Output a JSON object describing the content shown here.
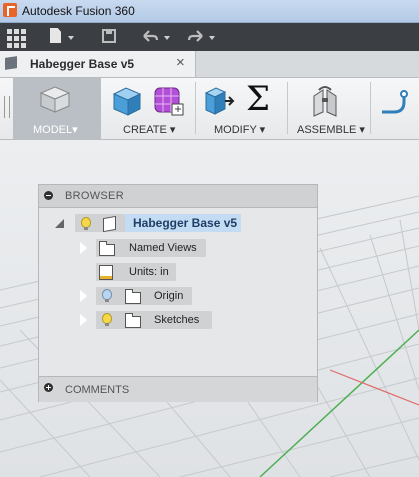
{
  "window": {
    "title": "Autodesk Fusion 360"
  },
  "quick_access": {
    "icons": [
      "apps-grid-icon",
      "file-icon",
      "save-icon",
      "undo-icon",
      "redo-icon"
    ]
  },
  "document_tab": {
    "label": "Habegger Base v5",
    "close": "×"
  },
  "ribbon": {
    "workspace_label": "MODEL▾",
    "groups": [
      {
        "label": "CREATE ▾",
        "icons": [
          "box-icon",
          "form-icon"
        ]
      },
      {
        "label": "MODIFY ▾",
        "icons": [
          "press-pull-icon",
          "sigma-icon"
        ]
      },
      {
        "label": "ASSEMBLE ▾",
        "icons": [
          "joint-icon"
        ]
      }
    ],
    "sigma_glyph": "Σ"
  },
  "browser": {
    "title": "BROWSER",
    "root": {
      "label": "Habegger Base v5"
    },
    "items": [
      {
        "label": "Named Views"
      },
      {
        "label": "Units: in"
      },
      {
        "label": "Origin"
      },
      {
        "label": "Sketches"
      }
    ]
  },
  "comments": {
    "title": "COMMENTS"
  },
  "colors": {
    "titlebar": "#b3c9e6",
    "toolbar_dark": "#3b3f44",
    "selected_node": "#c3dbf3",
    "axis_green": "#4caf50"
  }
}
